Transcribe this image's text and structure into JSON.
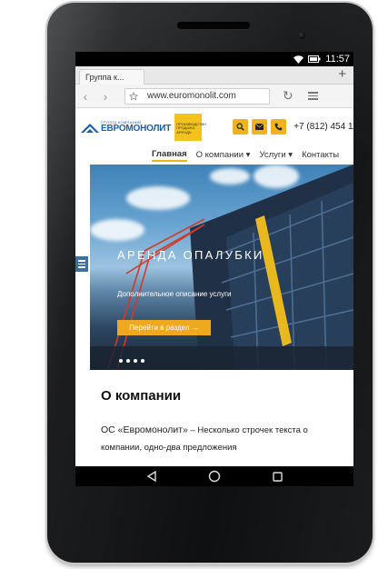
{
  "status_bar": {
    "time": "11:57"
  },
  "browser": {
    "tab_title": "Группа к...",
    "new_tab": "+",
    "back": "‹",
    "forward": "›",
    "url": "www.euromonolit.com",
    "reload": "↻"
  },
  "site": {
    "logo_small": "ГРУППА КОМПАНИЙ",
    "logo_name": "ЕВРОМОНОЛИТ",
    "logo_badge": "ПРОИЗВОДСТВО ПРОДАЖА АРЕНДА",
    "phone": "+7 (812) 454 11 04",
    "nav": [
      "Главная",
      "О компании ▾",
      "Услуги ▾",
      "Контакты"
    ]
  },
  "hero": {
    "title": "АРЕНДА ОПАЛУБКИ",
    "subtitle": "Дополнительное описание услуги",
    "button": "Перейти в раздел →"
  },
  "about": {
    "title": "О компании",
    "company": "ОС «Евромонолит»",
    "text": " –  Несколько строчек текста о компании, одно-два предложения"
  },
  "colors": {
    "accent": "#f0a81f",
    "brand": "#1a5fa6",
    "tablet": "#121314"
  },
  "icons": [
    "wifi-icon",
    "battery-icon",
    "star-icon",
    "search-icon",
    "mail-icon",
    "phone-icon",
    "menu-icon",
    "back-triangle-icon",
    "home-circle-icon",
    "recents-square-icon"
  ]
}
